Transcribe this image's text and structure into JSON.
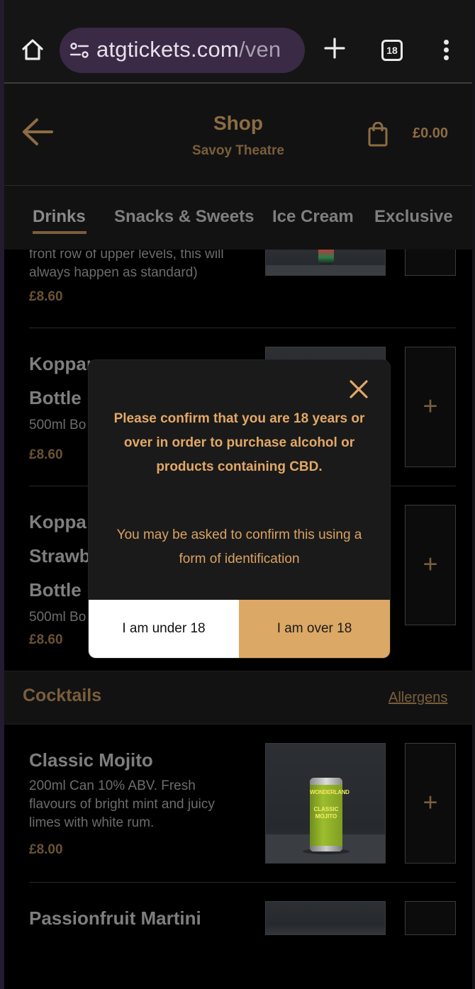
{
  "browser": {
    "url_main": "atgtickets.com",
    "url_rest": "/ven",
    "tab_count": "18"
  },
  "header": {
    "title": "Shop",
    "venue": "Savoy Theatre",
    "cart_total": "£0.00"
  },
  "categories": [
    {
      "label": "Drinks",
      "active": true
    },
    {
      "label": "Snacks & Sweets",
      "active": false
    },
    {
      "label": "Ice Cream",
      "active": false
    },
    {
      "label": "Exclusive",
      "active": false
    }
  ],
  "products": [
    {
      "name": "",
      "desc": "front row of upper levels, this will always happen as standard)",
      "price": "£8.60"
    },
    {
      "name_line1": "Koppar",
      "name_line2": "Bottle",
      "desc": "500ml Bo",
      "price": "£8.60"
    },
    {
      "name_line1": "Koppa",
      "name_line2": "Strawb",
      "name_line3": "Bottle",
      "desc": "500ml Bo",
      "price": "£8.60"
    }
  ],
  "cocktails_section": {
    "title": "Cocktails",
    "allergens_label": "Allergens",
    "items": [
      {
        "name": "Classic Mojito",
        "desc": "200ml Can 10% ABV. Fresh flavours of bright mint and juicy limes with white rum.",
        "price": "£8.00",
        "can_brand": "WONDERLAND",
        "can_name": "CLASSIC MOJITO"
      },
      {
        "name": "Passionfruit Martini"
      }
    ]
  },
  "modal": {
    "message": "Please confirm that you are 18 years or over in order to purchase alcohol or products containing CBD.",
    "note": "You may be asked to confirm this using a form of identification",
    "under_label": "I am under 18",
    "over_label": "I am over 18"
  },
  "colors": {
    "accent_gold": "#dca865",
    "brown_text": "#8c6c44",
    "url_pill": "#3a2a45"
  }
}
